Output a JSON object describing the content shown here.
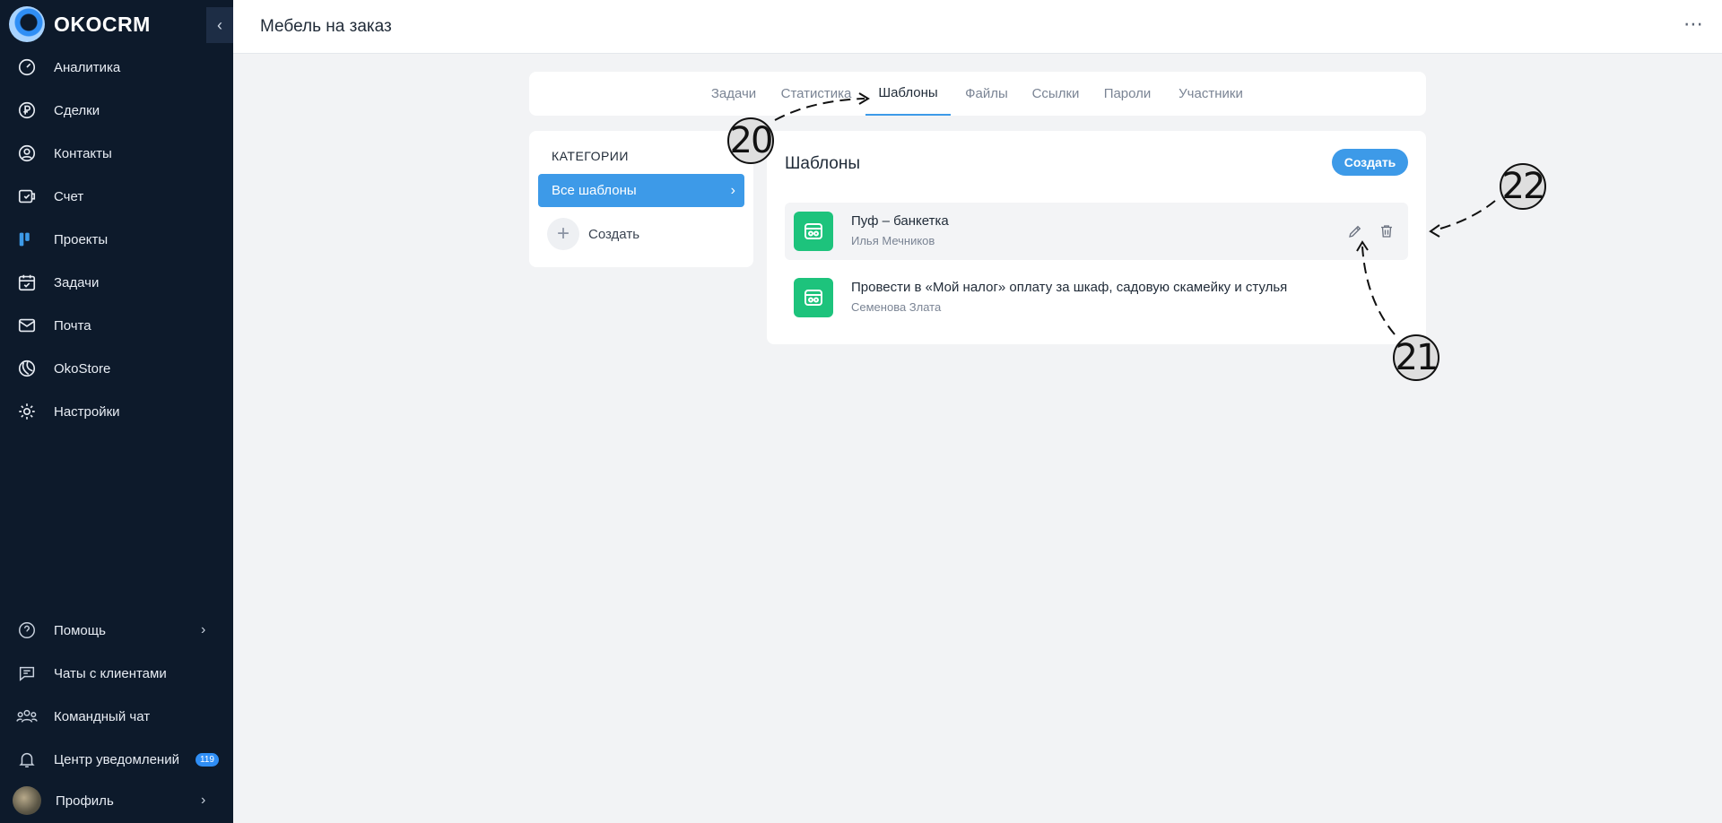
{
  "app": {
    "brand": "OKOCRM",
    "page_title": "Мебель на заказ"
  },
  "sidebar": {
    "items": [
      {
        "label": "Аналитика",
        "icon": "gauge-icon"
      },
      {
        "label": "Сделки",
        "icon": "ruble-icon"
      },
      {
        "label": "Контакты",
        "icon": "user-icon"
      },
      {
        "label": "Счет",
        "icon": "invoice-icon"
      },
      {
        "label": "Проекты",
        "icon": "kanban-icon"
      },
      {
        "label": "Задачи",
        "icon": "calendar-check-icon"
      },
      {
        "label": "Почта",
        "icon": "mail-icon"
      },
      {
        "label": "OkoStore",
        "icon": "store-icon"
      },
      {
        "label": "Настройки",
        "icon": "gear-icon"
      }
    ],
    "bottom": {
      "help": "Помощь",
      "client_chats": "Чаты с клиентами",
      "team_chat": "Командный чат",
      "notifications": "Центр уведомлений",
      "notifications_count": "119",
      "profile": "Профиль"
    }
  },
  "tabs": [
    "Задачи",
    "Статистика",
    "Шаблоны",
    "Файлы",
    "Ссылки",
    "Пароли",
    "Участники"
  ],
  "active_tab": "Шаблоны",
  "categories": {
    "title": "КАТЕГОРИИ",
    "active": "Все шаблоны",
    "create": "Создать"
  },
  "templates": {
    "title": "Шаблоны",
    "create_button": "Создать",
    "items": [
      {
        "name": "Пуф – банкетка",
        "author": "Илья Мечников"
      },
      {
        "name": "Провести в «Мой налог» оплату за шкаф, садовую скамейку и стулья",
        "author": "Семенова Злата"
      }
    ]
  },
  "annotations": [
    "20",
    "21",
    "22"
  ],
  "colors": {
    "sidebar_bg": "#0d1a2b",
    "accent": "#3d9ae8",
    "template_icon": "#1dc37c"
  }
}
